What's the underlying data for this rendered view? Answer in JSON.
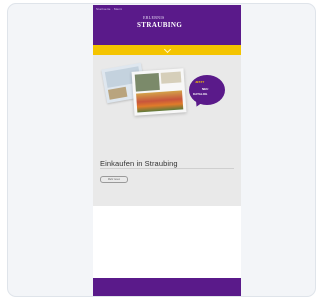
{
  "nav": {
    "tiny_text": "Startseite  ·  Menü"
  },
  "logo": {
    "top_text": "ERLEBNIS",
    "main_text": "STRAUBING"
  },
  "hero": {
    "bubble_line1": "JETZT",
    "bubble_line2": "NEU",
    "bubble_line3": "KATALOG"
  },
  "content": {
    "headline": "Einkaufen in Straubing",
    "button_label": "Mehr lesen"
  },
  "colors": {
    "brand_purple": "#5a1a8a",
    "accent_yellow": "#f4c400"
  }
}
